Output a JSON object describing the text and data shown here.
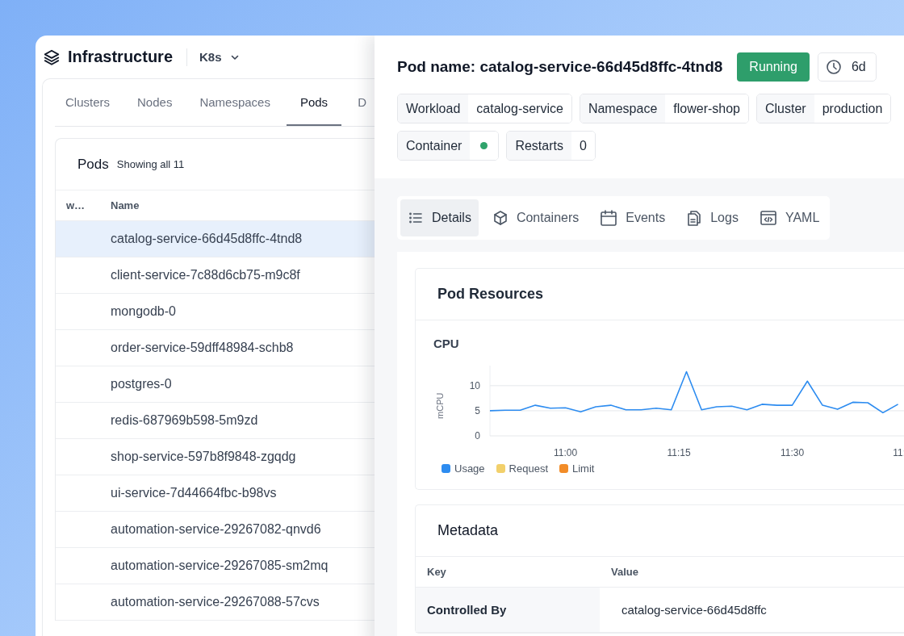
{
  "app": {
    "title": "Infrastructure",
    "context": "K8s"
  },
  "nav_tabs": [
    {
      "label": "Clusters",
      "selected": false
    },
    {
      "label": "Nodes",
      "selected": false
    },
    {
      "label": "Namespaces",
      "selected": false
    },
    {
      "label": "Pods",
      "selected": true
    },
    {
      "label": "D",
      "selected": false
    }
  ],
  "pods_table": {
    "title": "Pods",
    "count": "Showing all 11",
    "columns": [
      "w…",
      "Name"
    ],
    "rows": [
      {
        "name": "catalog-service-66d45d8ffc-4tnd8",
        "selected": true
      },
      {
        "name": "client-service-7c88d6cb75-m9c8f",
        "selected": false
      },
      {
        "name": "mongodb-0",
        "selected": false
      },
      {
        "name": "order-service-59dff48984-schb8",
        "selected": false
      },
      {
        "name": "postgres-0",
        "selected": false
      },
      {
        "name": "redis-687969b598-5m9zd",
        "selected": false
      },
      {
        "name": "shop-service-597b8f9848-zgqdg",
        "selected": false
      },
      {
        "name": "ui-service-7d44664fbc-b98vs",
        "selected": false
      },
      {
        "name": "automation-service-29267082-qnvd6",
        "selected": false
      },
      {
        "name": "automation-service-29267085-sm2mq",
        "selected": false
      },
      {
        "name": "automation-service-29267088-57cvs",
        "selected": false
      }
    ]
  },
  "pod_detail": {
    "title": "Pod name: catalog-service-66d45d8ffc-4tnd8",
    "status": "Running",
    "age": "6d",
    "chips": [
      {
        "kind": "text",
        "key": "Workload",
        "value": "catalog-service"
      },
      {
        "kind": "text",
        "key": "Namespace",
        "value": "flower-shop"
      },
      {
        "kind": "text",
        "key": "Cluster",
        "value": "production"
      },
      {
        "kind": "dot",
        "key": "Container",
        "color": "#2fa36b"
      },
      {
        "kind": "text",
        "key": "Restarts",
        "value": "0"
      }
    ],
    "tabs": [
      {
        "label": "Details",
        "selected": true
      },
      {
        "label": "Containers",
        "selected": false
      },
      {
        "label": "Events",
        "selected": false
      },
      {
        "label": "Logs",
        "selected": false
      },
      {
        "label": "YAML",
        "selected": false
      }
    ],
    "resources": {
      "title": "Pod Resources",
      "cpu": {
        "title": "CPU",
        "chart_data": {
          "type": "line",
          "ylabel": "mCPU",
          "x": [
            650,
            652,
            654,
            656,
            658,
            660,
            662,
            664,
            666,
            668,
            670,
            672,
            674,
            676,
            678,
            680,
            682,
            684,
            686,
            688,
            690,
            692,
            694,
            696,
            698,
            700,
            702,
            704
          ],
          "series": [
            {
              "name": "Usage",
              "color": "#2d8cf0",
              "values": [
                5.0,
                5.1,
                5.1,
                6.1,
                5.5,
                5.6,
                4.8,
                5.8,
                6.1,
                5.2,
                5.2,
                5.5,
                5.2,
                12.8,
                5.2,
                5.8,
                5.9,
                5.2,
                6.3,
                6.1,
                6.1,
                10.9,
                6.1,
                5.3,
                6.7,
                6.6,
                4.6,
                6.3
              ]
            },
            {
              "name": "Request",
              "color": "#f2d06b",
              "values": [
                null,
                null,
                null,
                null,
                null,
                null,
                null,
                null,
                null,
                null,
                null,
                null,
                null,
                null,
                null,
                null,
                null,
                null,
                null,
                null,
                null,
                null,
                null,
                null,
                null,
                null,
                null,
                null
              ]
            },
            {
              "name": "Limit",
              "color": "#f28c28",
              "values": [
                null,
                null,
                null,
                null,
                null,
                null,
                null,
                null,
                null,
                null,
                null,
                null,
                null,
                null,
                null,
                null,
                null,
                null,
                null,
                null,
                null,
                null,
                null,
                null,
                null,
                null,
                null,
                null
              ]
            }
          ],
          "xlim": [
            650,
            705
          ],
          "ylim": [
            0,
            14
          ],
          "xticks": [
            {
              "value": 660,
              "label": "11:00"
            },
            {
              "value": 675,
              "label": "11:15"
            },
            {
              "value": 690,
              "label": "11:30"
            }
          ],
          "yticks": [
            0,
            5,
            10
          ]
        },
        "cut_tick_label": "11:"
      }
    },
    "metadata": {
      "title": "Metadata",
      "columns": [
        "Key",
        "Value"
      ],
      "rows": [
        {
          "key": "Controlled By",
          "value": "catalog-service-66d45d8ffc"
        }
      ]
    }
  }
}
